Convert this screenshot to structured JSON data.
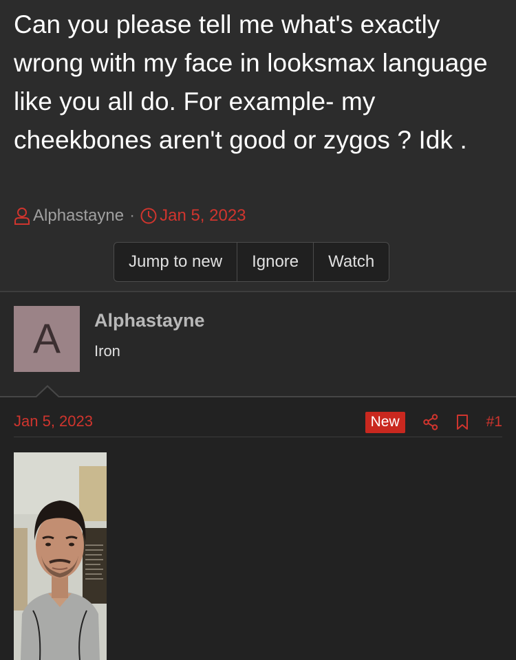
{
  "thread": {
    "title": "Can you please tell me what's exactly wrong with my face in looksmax language like you all do. For example- my cheekbones aren't good or zygos ? Idk .",
    "author": "Alphastayne",
    "separator": "·",
    "date": "Jan 5, 2023"
  },
  "actions": {
    "jump_to_new": "Jump to new",
    "ignore": "Ignore",
    "watch": "Watch"
  },
  "post": {
    "avatar_letter": "A",
    "username": "Alphastayne",
    "user_title": "Iron",
    "date": "Jan 5, 2023",
    "new_badge": "New",
    "post_number": "#1"
  },
  "icons": {
    "author": "user-icon",
    "date": "clock-icon",
    "share": "share-icon",
    "bookmark": "bookmark-icon"
  },
  "colors": {
    "accent": "#d0352e",
    "badge": "#c9281f",
    "avatar_bg": "#9b8387"
  }
}
